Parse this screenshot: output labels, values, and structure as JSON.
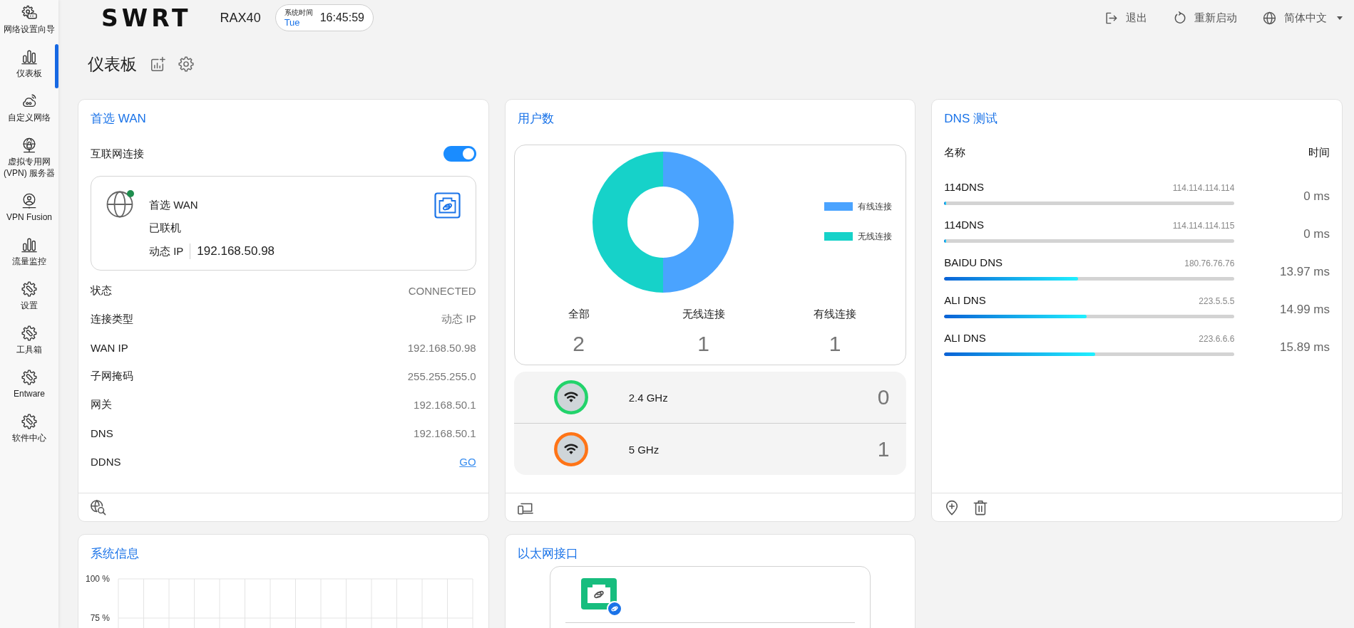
{
  "sidebar": {
    "items": [
      {
        "label": "网络设置向导",
        "kind": "setup",
        "selected": false
      },
      {
        "label": "仪表板",
        "kind": "chart",
        "selected": true
      },
      {
        "label": "自定义网络",
        "kind": "cloud",
        "selected": false
      },
      {
        "label": "虚拟专用网(VPN) 服务器",
        "kind": "vpn",
        "selected": false
      },
      {
        "label": "VPN Fusion",
        "kind": "fusion",
        "selected": false
      },
      {
        "label": "流量监控",
        "kind": "chart",
        "selected": false
      },
      {
        "label": "设置",
        "kind": "tool",
        "selected": false
      },
      {
        "label": "工具箱",
        "kind": "tool",
        "selected": false
      },
      {
        "label": "Entware",
        "kind": "tool",
        "selected": false
      },
      {
        "label": "软件中心",
        "kind": "tool",
        "selected": false
      }
    ]
  },
  "header": {
    "logo": "SWRT",
    "model": "RAX40",
    "clock": {
      "label": "系统时间",
      "day": "Tue",
      "time": "16:45:59"
    },
    "actions": [
      {
        "label": "退出",
        "kind": "logout"
      },
      {
        "label": "重新启动",
        "kind": "restart"
      },
      {
        "label": "简体中文",
        "kind": "language"
      }
    ]
  },
  "page": {
    "title": "仪表板"
  },
  "wan": {
    "title": "首选 WAN",
    "internet": {
      "label": "互联网连接",
      "on": true
    },
    "connection": {
      "name": "首选 WAN",
      "status": "已联机",
      "type": "动态 IP",
      "ip": "192.168.50.98",
      "online": true
    },
    "rows": [
      {
        "label": "状态",
        "value": "CONNECTED",
        "kind": "text"
      },
      {
        "label": "连接类型",
        "value": "动态 IP",
        "kind": "text"
      },
      {
        "label": "WAN IP",
        "value": "192.168.50.98",
        "kind": "text"
      },
      {
        "label": "子网掩码",
        "value": "255.255.255.0",
        "kind": "text"
      },
      {
        "label": "网关",
        "value": "192.168.50.1",
        "kind": "text"
      },
      {
        "label": "DNS",
        "value": "192.168.50.1",
        "kind": "text"
      },
      {
        "label": "DDNS",
        "value": "GO",
        "kind": "link"
      }
    ]
  },
  "users": {
    "title": "用户数",
    "chart_data": {
      "type": "donut",
      "categories": [
        "有线连接",
        "无线连接"
      ],
      "values": [
        50,
        50
      ],
      "colors": [
        "#4aa3ff",
        "#16d2c9"
      ],
      "legend": "right"
    },
    "stats": [
      {
        "label": "全部",
        "value": "2"
      },
      {
        "label": "无线连接",
        "value": "1"
      },
      {
        "label": "有线连接",
        "value": "1"
      }
    ],
    "bands": [
      {
        "label": "2.4 GHz",
        "count": "0",
        "color": "#22d36b"
      },
      {
        "label": "5 GHz",
        "count": "1",
        "color": "#ff7417"
      }
    ]
  },
  "dns": {
    "title": "DNS 测试",
    "columns": [
      "名称",
      "时间"
    ],
    "rows": [
      {
        "name": "114DNS",
        "ip": "114.114.114.114",
        "level": 0,
        "time": "0 ms"
      },
      {
        "name": "114DNS",
        "ip": "114.114.114.115",
        "level": 0,
        "time": "0 ms"
      },
      {
        "name": "BAIDU DNS",
        "ip": "180.76.76.76",
        "level": 0.46,
        "time": "13.97 ms"
      },
      {
        "name": "ALI DNS",
        "ip": "223.5.5.5",
        "level": 0.49,
        "time": "14.99 ms"
      },
      {
        "name": "ALI DNS",
        "ip": "223.6.6.6",
        "level": 0.52,
        "time": "15.89 ms"
      }
    ]
  },
  "system": {
    "title": "系统信息",
    "axis_labels": [
      "100 %",
      "75 %"
    ]
  },
  "ethernet": {
    "title": "以太网接口",
    "ports": [
      {
        "connected": true
      }
    ]
  }
}
